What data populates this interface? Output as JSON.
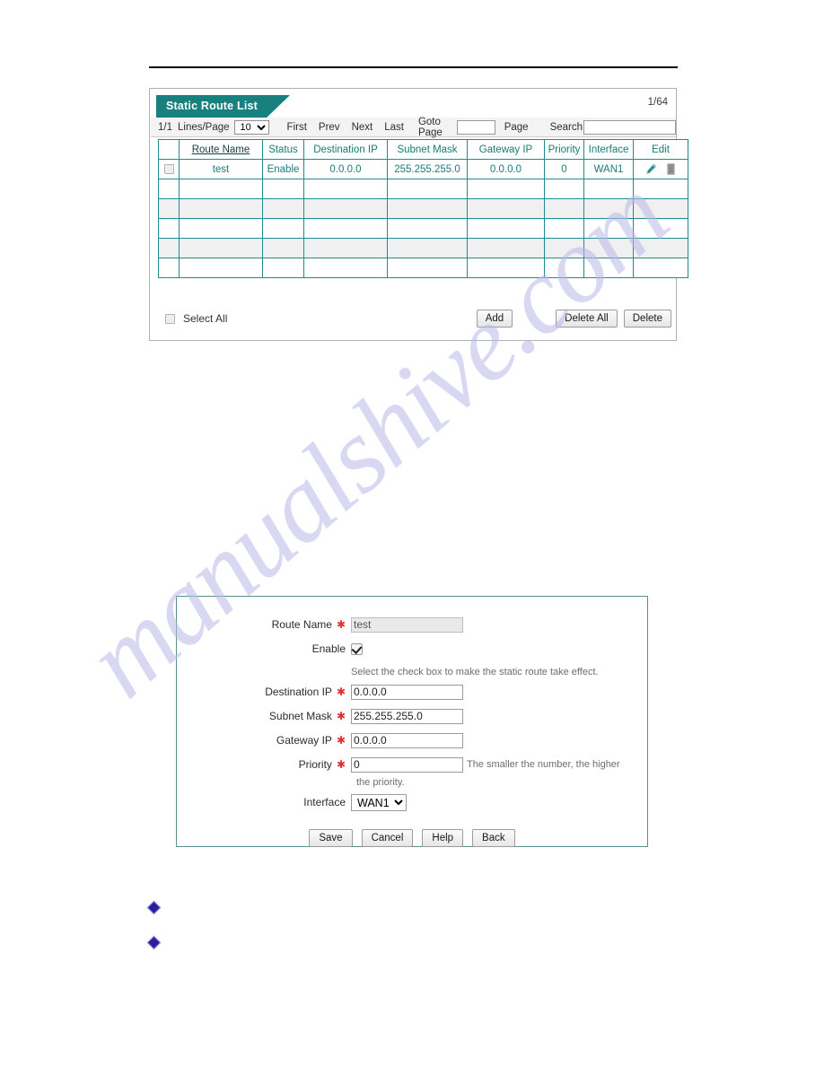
{
  "watermark": {
    "text": "manualshive.com"
  },
  "list_panel": {
    "tab_title": "Static Route List",
    "entry_counter": "1/64",
    "pagination": {
      "page_ratio": "1/1",
      "lines_per_page_label": "Lines/Page",
      "lines_per_page_value": "10",
      "lines_per_page_options": [
        "10"
      ],
      "first_label": "First",
      "prev_label": "Prev",
      "next_label": "Next",
      "last_label": "Last",
      "goto_label": "Goto Page",
      "goto_value": "",
      "page_word": "Page",
      "search_label": "Search",
      "search_value": ""
    },
    "columns": [
      "",
      "Route Name",
      "Status",
      "Destination IP",
      "Subnet Mask",
      "Gateway IP",
      "Priority",
      "Interface",
      "Edit"
    ],
    "rows": [
      {
        "route_name": "test",
        "status": "Enable",
        "destination_ip": "0.0.0.0",
        "subnet_mask": "255.255.255.0",
        "gateway_ip": "0.0.0.0",
        "priority": "0",
        "interface": "WAN1",
        "edit_icons": [
          "pencil-icon",
          "trash-icon"
        ]
      }
    ],
    "empty_row_count": 5,
    "footer": {
      "select_all_label": "Select All",
      "add_label": "Add",
      "delete_all_label": "Delete All",
      "delete_label": "Delete"
    }
  },
  "form_panel": {
    "fields": {
      "route_name_label": "Route Name",
      "route_name_value": "test",
      "enable_label": "Enable",
      "enable_checked": true,
      "enable_hint": "Select the check box to make the static route take effect.",
      "destination_ip_label": "Destination IP",
      "destination_ip_value": "0.0.0.0",
      "subnet_mask_label": "Subnet Mask",
      "subnet_mask_value": "255.255.255.0",
      "gateway_ip_label": "Gateway IP",
      "gateway_ip_value": "0.0.0.0",
      "priority_label": "Priority",
      "priority_value": "0",
      "priority_hint_line1": "The smaller the number, the higher",
      "priority_hint_line2": "the priority.",
      "interface_label": "Interface",
      "interface_value": "WAN1",
      "interface_options": [
        "WAN1"
      ]
    },
    "buttons": {
      "save_label": "Save",
      "cancel_label": "Cancel",
      "help_label": "Help",
      "back_label": "Back"
    }
  },
  "colors": {
    "teal": "#18807f",
    "table_border": "#1f8d8b",
    "required_star": "#e03030",
    "bullet": "#2b1e9e"
  }
}
